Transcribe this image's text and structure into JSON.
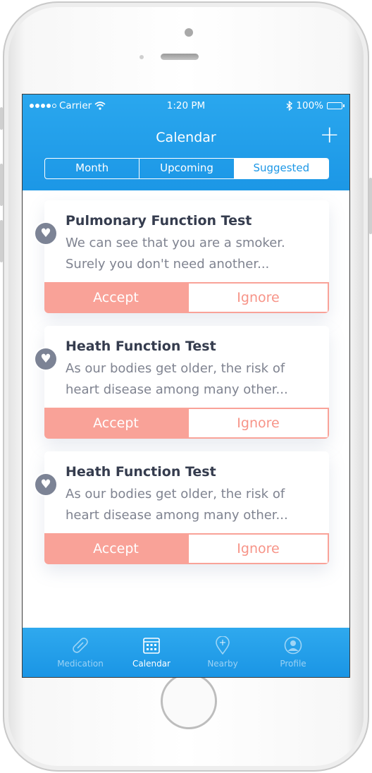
{
  "status_bar": {
    "carrier": "Carrier",
    "time": "1:20 PM",
    "battery": "100%"
  },
  "header": {
    "title": "Calendar",
    "add_icon": "+"
  },
  "segments": [
    {
      "label": "Month"
    },
    {
      "label": "Upcoming"
    },
    {
      "label": "Suggested"
    }
  ],
  "active_segment": "Suggested",
  "cards": [
    {
      "title": "Pulmonary Function Test",
      "line1": "We can see that you are a smoker.",
      "line2": "Surely you don't need another...",
      "accept": "Accept",
      "ignore": "Ignore"
    },
    {
      "title": "Heath Function Test",
      "line1": "As our bodies get older, the risk of",
      "line2": "heart disease among many other...",
      "accept": "Accept",
      "ignore": "Ignore"
    },
    {
      "title": "Heath Function Test",
      "line1": "As our bodies get older, the risk of",
      "line2": "heart disease among many other...",
      "accept": "Accept",
      "ignore": "Ignore"
    }
  ],
  "tabbar": [
    {
      "label": "Medication",
      "icon": "pill-icon"
    },
    {
      "label": "Calendar",
      "icon": "calendar-icon"
    },
    {
      "label": "Nearby",
      "icon": "location-pin-icon"
    },
    {
      "label": "Profile",
      "icon": "profile-icon"
    }
  ],
  "colors": {
    "accent": "#1c97e6",
    "accept": "#f9a298",
    "heart": "#7c8395"
  }
}
